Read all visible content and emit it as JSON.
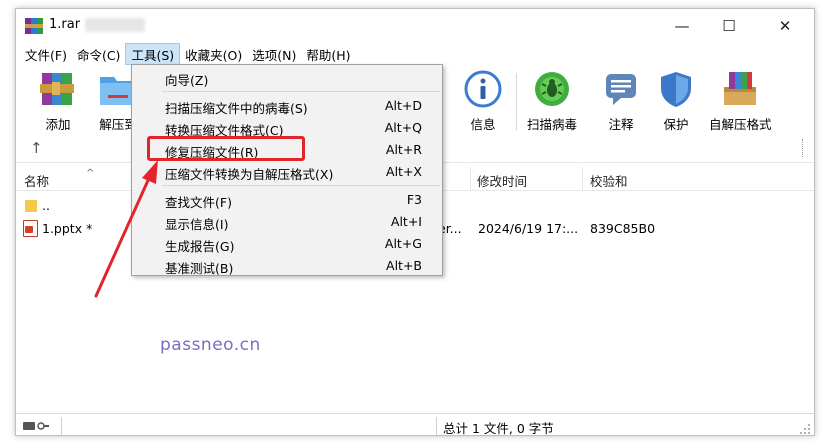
{
  "window": {
    "title": "1.rar",
    "controls": {
      "minimize": "—",
      "maximize": "☐",
      "close": "✕"
    }
  },
  "menubar": [
    {
      "label": "文件(F)"
    },
    {
      "label": "命令(C)"
    },
    {
      "label": "工具(S)",
      "active": true
    },
    {
      "label": "收藏夹(O)"
    },
    {
      "label": "选项(N)"
    },
    {
      "label": "帮助(H)"
    }
  ],
  "toolbar": {
    "add": "添加",
    "extract": "解压到",
    "info": "信息",
    "scan": "扫描病毒",
    "comment": "注释",
    "protect": "保护",
    "sfx": "自解压格式",
    "icons": {
      "add": "archive-add-icon",
      "extract": "folder-extract-icon",
      "info": "info-icon",
      "scan": "virus-scan-icon",
      "comment": "comment-icon",
      "protect": "shield-icon",
      "sfx": "sfx-icon"
    }
  },
  "columns": {
    "name": "名称",
    "modified": "修改时间",
    "checksum": "校验和"
  },
  "files": [
    {
      "name": "..",
      "icon": "folder-up-icon"
    },
    {
      "name": "1.pptx *",
      "icon": "pptx-icon",
      "type_partial": "er...",
      "modified": "2024/6/19 17:...",
      "checksum": "839C85B0"
    }
  ],
  "tools_menu": [
    {
      "label": "向导(Z)",
      "shortcut": ""
    },
    {
      "label": "扫描压缩文件中的病毒(S)",
      "shortcut": "Alt+D"
    },
    {
      "label": "转换压缩文件格式(C)",
      "shortcut": "Alt+Q"
    },
    {
      "label": "修复压缩文件(R)",
      "shortcut": "Alt+R",
      "highlighted": true
    },
    {
      "label": "压缩文件转换为自解压格式(X)",
      "shortcut": "Alt+X"
    },
    {
      "label": "查找文件(F)",
      "shortcut": "F3"
    },
    {
      "label": "显示信息(I)",
      "shortcut": "Alt+I"
    },
    {
      "label": "生成报告(G)",
      "shortcut": "Alt+G"
    },
    {
      "label": "基准测试(B)",
      "shortcut": "Alt+B"
    }
  ],
  "status": {
    "summary": "总计 1 文件, 0 字节"
  },
  "watermark": "passneo.cn",
  "colors": {
    "highlight": "#e3252b",
    "menu_active_bg": "#cce4f7",
    "watermark": "#7b6cc6"
  }
}
